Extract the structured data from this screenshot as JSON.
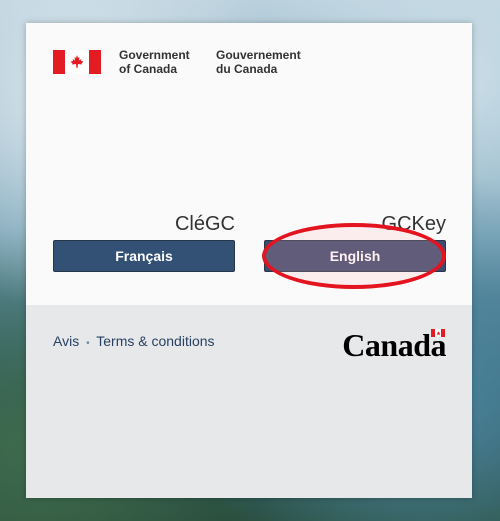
{
  "header": {
    "gov_en_line1": "Government",
    "gov_en_line2": "of Canada",
    "gov_fr_line1": "Gouvernement",
    "gov_fr_line2": "du Canada"
  },
  "product": {
    "name_fr": "CléGC",
    "name_en": "GCKey"
  },
  "buttons": {
    "french": "Français",
    "english": "English"
  },
  "footer": {
    "notice": "Avis",
    "separator": "•",
    "terms": "Terms & conditions",
    "wordmark": "Canada"
  },
  "colors": {
    "flag_red": "#e31b23",
    "button_blue": "#335075",
    "highlight_red": "#e3131f"
  },
  "icons": {
    "flag": "canada-flag-icon",
    "wordmark_flag": "canada-wordmark-flag-icon"
  }
}
